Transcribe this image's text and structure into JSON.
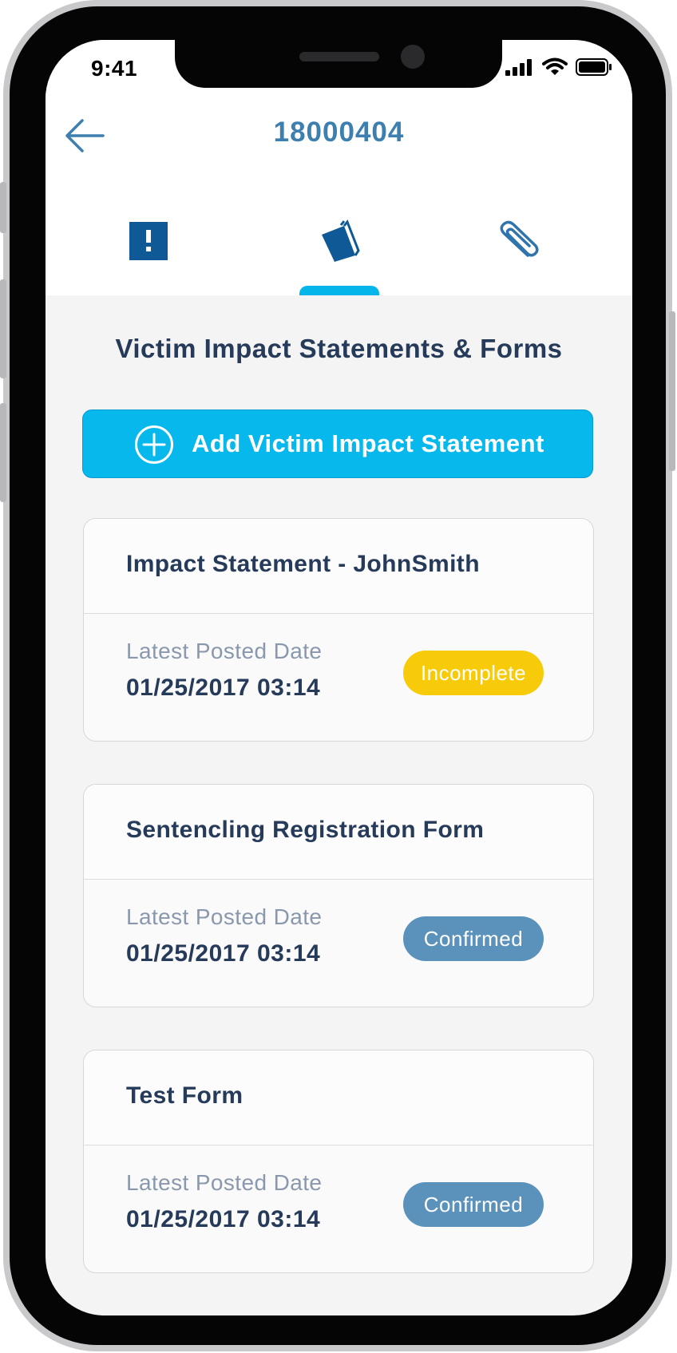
{
  "status_bar": {
    "time": "9:41"
  },
  "header": {
    "case_number": "18000404"
  },
  "tabs": [
    {
      "icon": "alert-icon",
      "active": false
    },
    {
      "icon": "documents-icon",
      "active": true
    },
    {
      "icon": "paperclip-icon",
      "active": false
    }
  ],
  "main": {
    "section_title": "Victim Impact Statements & Forms",
    "add_button_label": "Add Victim Impact Statement",
    "cards": [
      {
        "title": "Impact Statement - JohnSmith",
        "date_label": "Latest Posted Date",
        "date_value": "01/25/2017 03:14",
        "status": "Incomplete",
        "status_color": "#f7cb0a"
      },
      {
        "title": "Sentencling Registration Form",
        "date_label": "Latest Posted Date",
        "date_value": "01/25/2017 03:14",
        "status": "Confirmed",
        "status_color": "#5b92bc"
      },
      {
        "title": "Test Form",
        "date_label": "Latest Posted Date",
        "date_value": "01/25/2017 03:14",
        "status": "Confirmed",
        "status_color": "#5b92bc"
      }
    ]
  },
  "colors": {
    "accent": "#06b8ec",
    "primary_text": "#263a5a",
    "brand_blue": "#3d7fae"
  }
}
